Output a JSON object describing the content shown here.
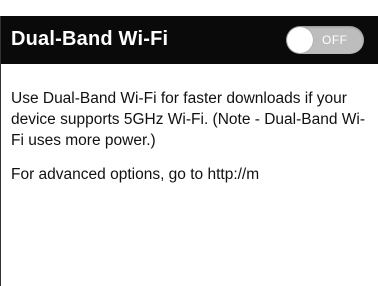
{
  "header": {
    "title": "Dual-Band Wi-Fi",
    "toggle": {
      "state_label": "OFF",
      "is_on": false
    }
  },
  "content": {
    "description": "Use Dual-Band Wi-Fi for faster downloads if your device supports 5GHz Wi-Fi. (Note - Dual-Band Wi-Fi uses more power.)",
    "advanced_text": "For advanced options, go to http://m"
  },
  "colors": {
    "header_bg": "#0a0a0a",
    "header_text": "#ffffff",
    "toggle_off_bg": "#bdbdbd",
    "body_text": "#111111"
  }
}
